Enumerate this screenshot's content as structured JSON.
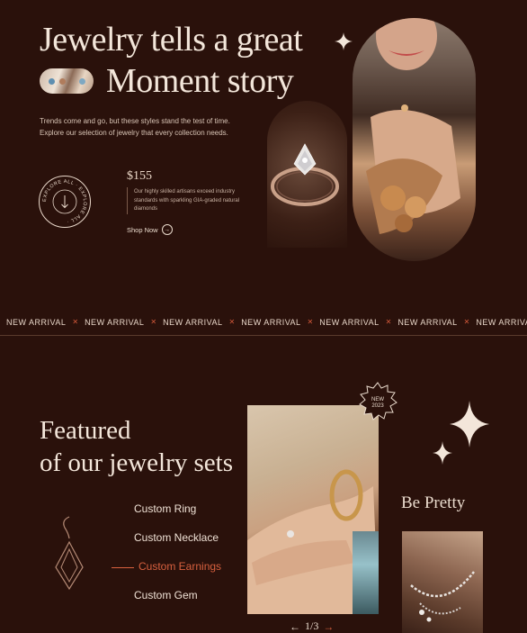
{
  "hero": {
    "title_line1": "Jewelry tells a great",
    "title_line2": "Moment story",
    "description": "Trends come and go, but these styles stand the test of time. Explore our selection of jewelry that every collection needs.",
    "badge_text": "EXPLORE ALL · EXPLORE ALL ·",
    "price": "$155",
    "price_description": "Our highly skilled artisans exceed industry standards with sparkling GIA-graded natural diamonds",
    "shop_now": "Shop Now",
    "shop_arrow": "→"
  },
  "marquee": {
    "label": "NEW ARRIVAL",
    "separator": "✕",
    "repeat": 8
  },
  "featured": {
    "title_line1": "Featured",
    "title_line2": "of our jewelry sets",
    "menu": [
      "Custom Ring",
      "Custom Necklace",
      "Custom Earnings",
      "Custom Gem"
    ],
    "active_index": 2,
    "new_badge_line1": "NEW",
    "new_badge_line2": "2023",
    "be_pretty": "Be Pretty",
    "pager": {
      "prev": "←",
      "current": "1/3",
      "next": "→"
    }
  },
  "colors": {
    "background": "#2a110b",
    "text": "#f1e3d7",
    "accent": "#d8613f"
  },
  "icons": {
    "sparkle": "sparkle-icon",
    "arrow_down": "arrow-down-icon",
    "earring": "earring-outline-icon"
  }
}
